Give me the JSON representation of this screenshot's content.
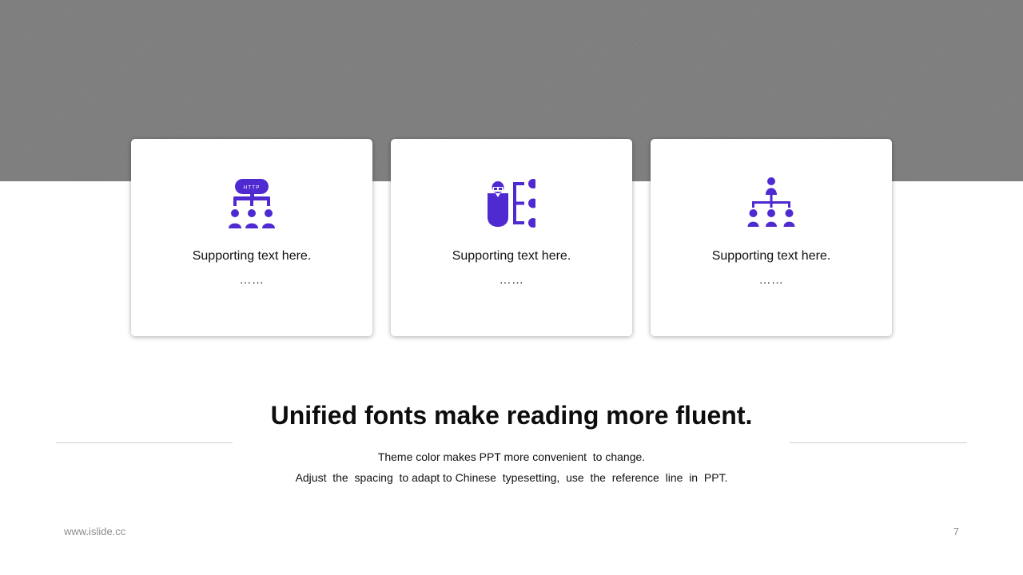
{
  "theme": {
    "accent_color": "#4f2ad0",
    "band_color": "#7f7f7f"
  },
  "cards": [
    {
      "icon": "http-network-users-icon",
      "icon_label": "HTTP",
      "text": "Supporting text here.",
      "dots": "……"
    },
    {
      "icon": "presenter-list-icon",
      "text": "Supporting text here.",
      "dots": "……"
    },
    {
      "icon": "org-chart-icon",
      "text": "Supporting text here.",
      "dots": "……"
    }
  ],
  "headline": "Unified fonts make reading more fluent.",
  "body_lines": [
    "Theme color makes PPT more convenient  to change.",
    "Adjust  the  spacing  to adapt to Chinese  typesetting,  use  the  reference  line  in  PPT."
  ],
  "footer": {
    "url": "www.islide.cc",
    "page_number": "7"
  }
}
